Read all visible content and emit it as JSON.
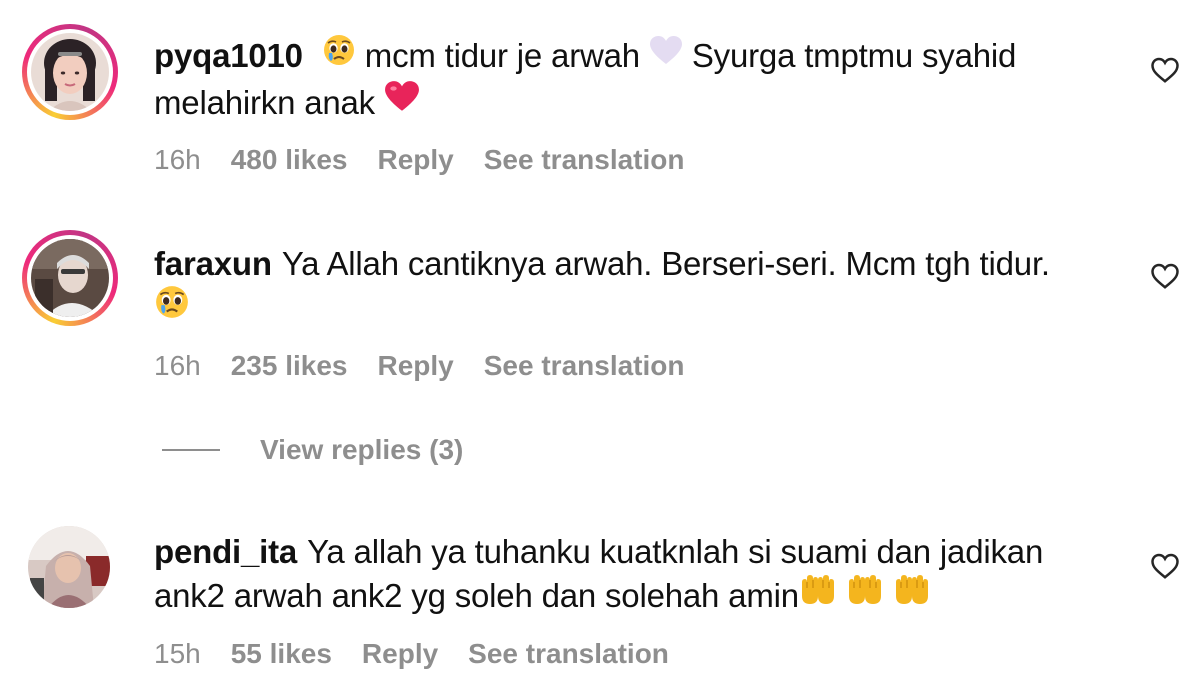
{
  "comments": [
    {
      "username": "pyqa1010",
      "text_part1": "mcm tidur je arwah",
      "text_part2": "Syurga tmptmu syahid melahirkn anak",
      "time": "16h",
      "likes": "480 likes",
      "reply": "Reply",
      "translate": "See translation"
    },
    {
      "username": "faraxun",
      "text": "Ya Allah cantiknya arwah. Berseri-seri. Mcm tgh tidur.",
      "time": "16h",
      "likes": "235 likes",
      "reply": "Reply",
      "translate": "See translation",
      "view_replies": "View replies (3)"
    },
    {
      "username": "pendi_ita",
      "text": "Ya allah ya tuhanku kuatknlah si suami dan jadikan ank2 arwah ank2 yg soleh dan solehah amin",
      "time": "15h",
      "likes": "55 likes",
      "reply": "Reply",
      "translate": "See translation"
    }
  ],
  "icons": {
    "like": "heart-outline-icon",
    "pleading": "pleading-face-emoji",
    "white_heart": "white-heart-emoji",
    "red_heart": "red-heart-emoji",
    "hands": "raising-hands-emoji"
  },
  "colors": {
    "text": "#111111",
    "muted": "#8e8e8e",
    "ring_start": "#f9ce34",
    "ring_mid": "#ee2a7b"
  }
}
